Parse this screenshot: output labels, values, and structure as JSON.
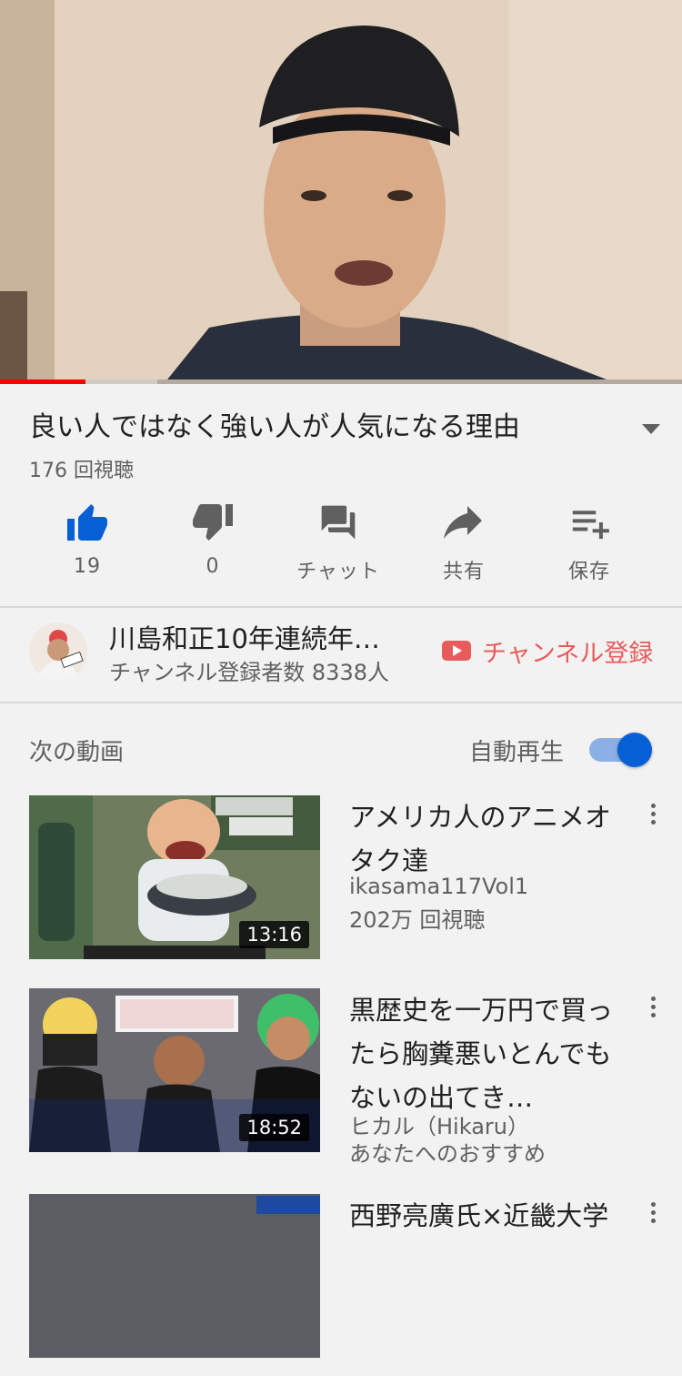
{
  "player": {
    "progress_played": 0.125,
    "progress_buffered": 0.23
  },
  "video": {
    "title": "良い人ではなく強い人が人気になる理由",
    "views": "176 回視聴"
  },
  "actions": {
    "like": {
      "count": "19",
      "icon": "thumb-up-icon",
      "color": "#065fd4"
    },
    "dislike": {
      "count": "0",
      "icon": "thumb-down-icon"
    },
    "chat": {
      "label": "チャット",
      "icon": "chat-icon"
    },
    "share": {
      "label": "共有",
      "icon": "share-icon"
    },
    "save": {
      "label": "保存",
      "icon": "playlist-add-icon"
    }
  },
  "channel": {
    "name": "川島和正10年連続年…",
    "subscribers": "チャンネル登録者数 8338人",
    "subscribe_label": "チャンネル登録",
    "subscribe_color": "#e85b5b"
  },
  "up_next": {
    "label": "次の動画",
    "autoplay_label": "自動再生",
    "autoplay_on": true,
    "items": [
      {
        "title": "アメリカ人のアニメオタク達",
        "channel": "ikasama117Vol1",
        "meta": "202万 回視聴",
        "duration": "13:16"
      },
      {
        "title": "黒歴史を一万円で買ったら胸糞悪いとんでもないの出てき…",
        "channel": "ヒカル（Hikaru）",
        "meta": "あなたへのおすすめ",
        "duration": "18:52"
      },
      {
        "title": "西野亮廣氏×近畿大学"
      }
    ]
  }
}
